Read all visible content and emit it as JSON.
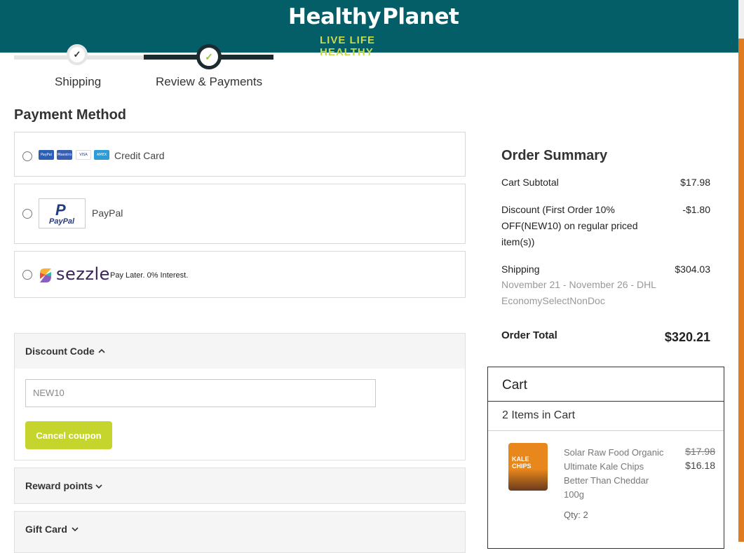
{
  "brand": {
    "name_part1": "Healthy",
    "name_part2": "Planet",
    "tagline": "LIVE LIFE HEALTHY"
  },
  "stepper": {
    "steps": [
      {
        "label": "Shipping",
        "state": "completed"
      },
      {
        "label": "Review & Payments",
        "state": "current"
      }
    ],
    "check_glyph": "✓"
  },
  "payment": {
    "title": "Payment Method",
    "options": [
      {
        "label": "Credit Card",
        "cards": [
          "PayPal",
          "Maestro",
          "VISA",
          "AMEX"
        ]
      },
      {
        "label": "PayPal",
        "logo_text": "PayPal"
      },
      {
        "label": "sezzle",
        "tagline": "Pay Later. 0% Interest."
      }
    ]
  },
  "discount": {
    "title": "Discount Code",
    "input_value": "NEW10",
    "cancel_label": "Cancel coupon",
    "expanded": true
  },
  "reward": {
    "title": "Reward points"
  },
  "gift": {
    "title": "Gift Card"
  },
  "summary": {
    "title": "Order Summary",
    "subtotal_label": "Cart Subtotal",
    "subtotal_value": "$17.98",
    "discount_label": "Discount (First Order 10% OFF(NEW10) on regular priced item(s))",
    "discount_value": "-$1.80",
    "shipping_label": "Shipping",
    "shipping_value": "$304.03",
    "shipping_detail": "November 21 - November 26 - DHL EconomySelectNonDoc",
    "total_label": "Order Total",
    "total_value": "$320.21"
  },
  "cart": {
    "title": "Cart",
    "count_text": "2 Items in Cart",
    "items": [
      {
        "name": "Solar Raw Food Organic Ultimate Kale Chips Better Than Cheddar 100g",
        "old_price": "$17.98",
        "price": "$16.18",
        "qty": "Qty: 2",
        "image_text": "KALE CHIPS"
      }
    ]
  },
  "colors": {
    "header_bg": "#035e68",
    "accent_green": "#c6d42e",
    "scroll_thumb": "#e07b20"
  }
}
